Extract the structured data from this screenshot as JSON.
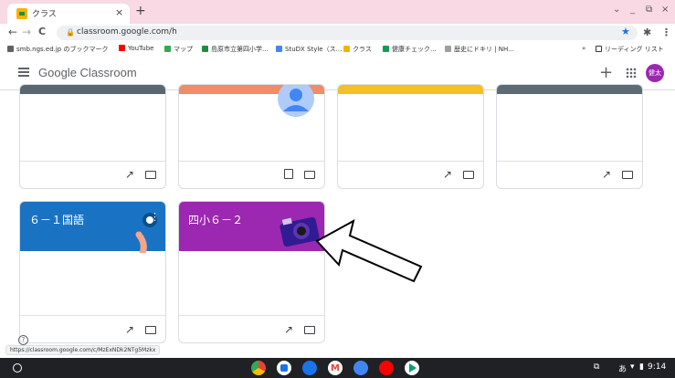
{
  "browser": {
    "tab_title": "クラス",
    "tab_close": "×",
    "new_tab": "+",
    "window_controls": [
      "⌄",
      "_",
      "⧉",
      "×"
    ],
    "nav": {
      "back": "←",
      "forward": "→",
      "reload": "C"
    },
    "url": "classroom.google.com/h",
    "bookmarks": [
      {
        "label": "smb.ngs.ed.jp のブックマーク",
        "color": "#5f6368"
      },
      {
        "label": "YouTube",
        "color": "#ff0000"
      },
      {
        "label": "マップ",
        "color": "#34a853"
      },
      {
        "label": "島原市立第四小学...",
        "color": "#1e8e3e"
      },
      {
        "label": "StuDX Style（ス...",
        "color": "#4285f4"
      },
      {
        "label": "クラス",
        "color": "#f4b400"
      },
      {
        "label": "健康チェック...",
        "color": "#0f9d58"
      },
      {
        "label": "歴史にドキリ | NH...",
        "color": "#9aa0a6"
      }
    ],
    "bookmarks_overflow": "»",
    "reading_list": "リーディング リスト"
  },
  "app": {
    "logo_google": "Google",
    "logo_classroom": "Classroom",
    "avatar_label": "健太",
    "avatar_color": "#9c27b0"
  },
  "cards": [
    {
      "title": "",
      "band_color": "#5b6770"
    },
    {
      "title": "",
      "band_color": "#f28b67"
    },
    {
      "title": "",
      "band_color": "#f6bf26"
    },
    {
      "title": "",
      "band_color": "#5f6b74"
    },
    {
      "title": "６－１国語",
      "band_color": "#1a73c2"
    },
    {
      "title": "四小６－２",
      "band_color": "#9c27b0"
    }
  ],
  "status_url": "https://classroom.google.com/c/MzExNDk2NTg5Mzkx",
  "shelf": {
    "time": "9:14",
    "ime": "あ",
    "apps": [
      {
        "name": "chrome",
        "color": "#ea4335"
      },
      {
        "name": "meet",
        "color": "#1a73e8"
      },
      {
        "name": "files",
        "color": "#1a73e8"
      },
      {
        "name": "gmail",
        "color": "#ffffff"
      },
      {
        "name": "docs",
        "color": "#4285f4"
      },
      {
        "name": "youtube",
        "color": "#ff0000"
      },
      {
        "name": "play",
        "color": "#ffffff"
      }
    ]
  }
}
